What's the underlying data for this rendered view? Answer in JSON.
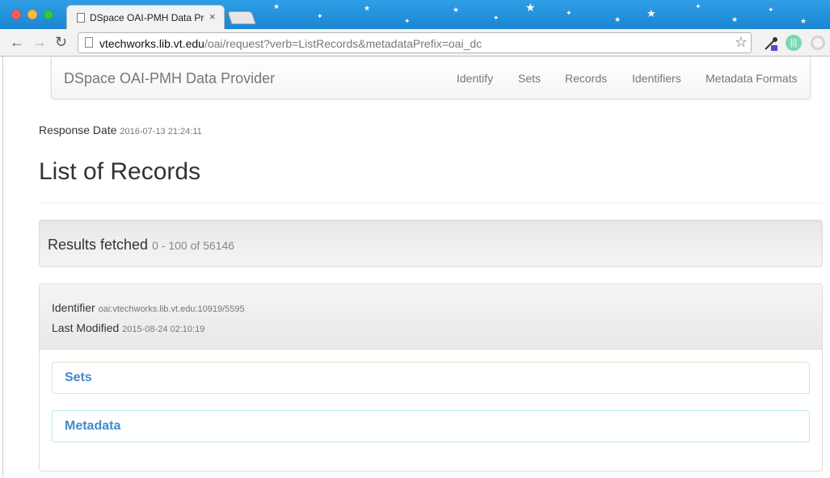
{
  "browser": {
    "tab_title": "DSpace OAI-PMH Data Provider",
    "tab_close": "×",
    "url_host": "vtechworks.lib.vt.edu",
    "url_path": "/oai/request?verb=ListRecords&metadataPrefix=oai_dc",
    "back": "←",
    "forward": "→",
    "reload": "↻",
    "bookmark": "☆"
  },
  "navbar": {
    "brand": "DSpace OAI-PMH Data Provider",
    "links": [
      "Identify",
      "Sets",
      "Records",
      "Identifiers",
      "Metadata Formats"
    ]
  },
  "response": {
    "label": "Response Date",
    "value": "2016-07-13 21:24:11"
  },
  "page_title": "List of Records",
  "results": {
    "label": "Results fetched",
    "range": "0 - 100 of 56146"
  },
  "record": {
    "identifier_label": "Identifier",
    "identifier_value": "oai:vtechworks.lib.vt.edu:10919/5595",
    "modified_label": "Last Modified",
    "modified_value": "2015-08-24 02:10:19",
    "sets_label": "Sets",
    "metadata_label": "Metadata"
  },
  "colors": {
    "tabbar": "#1b86d2",
    "link": "#428bca",
    "sets_border": "#d6e9c6",
    "metadata_border": "#bce8f1"
  },
  "icons": [
    "page-icon",
    "bookmark-star-icon",
    "eyedropper-extension-icon",
    "audio-extension-icon",
    "circle-extension-icon"
  ]
}
